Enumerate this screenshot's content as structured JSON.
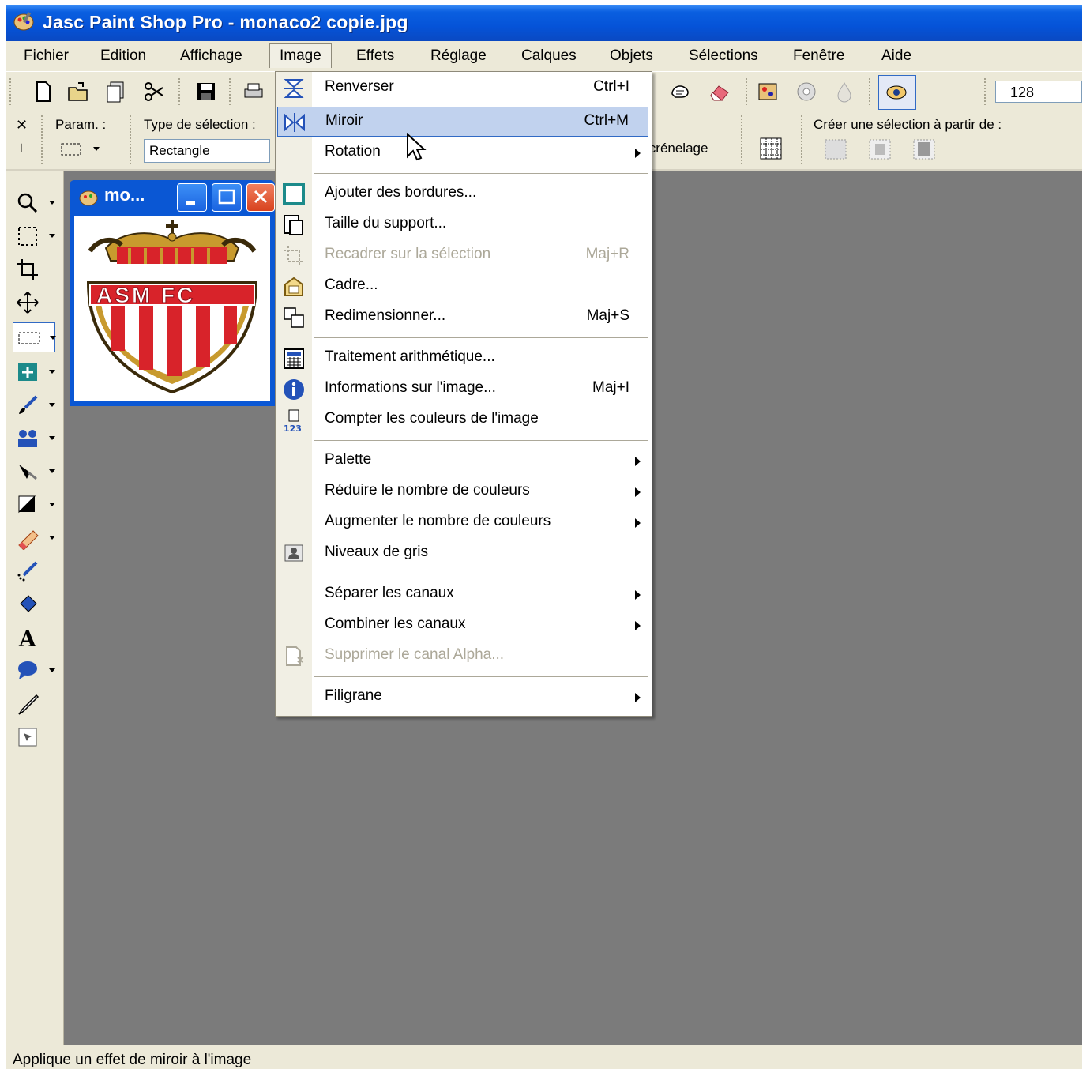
{
  "window": {
    "title": "Jasc Paint Shop Pro - monaco2 copie.jpg"
  },
  "menubar": {
    "items": [
      "Fichier",
      "Edition",
      "Affichage",
      "Image",
      "Effets",
      "Réglage",
      "Calques",
      "Objets",
      "Sélections",
      "Fenêtre",
      "Aide"
    ],
    "active": "Image"
  },
  "toolbar": {
    "size_value": "128"
  },
  "tool_options": {
    "param_label": "Param. :",
    "selection_type_label": "Type de sélection :",
    "selection_type_value": "Rectangle",
    "antialias_partial": "icrénelage",
    "create_selection_label": "Créer une sélection à partir de :"
  },
  "image_window": {
    "title": "mo...",
    "logo_text": "ASM FC"
  },
  "image_menu": {
    "items": [
      {
        "label": "Renverser",
        "shortcut": "Ctrl+I",
        "icon": "flip-icon"
      },
      {
        "label": "Miroir",
        "shortcut": "Ctrl+M",
        "icon": "mirror-icon",
        "highlighted": true
      },
      {
        "label": "Rotation",
        "submenu": true
      },
      {
        "label": "Ajouter des bordures...",
        "icon": "add-borders-icon"
      },
      {
        "label": "Taille du support...",
        "icon": "canvas-size-icon"
      },
      {
        "label": "Recadrer sur la sélection",
        "shortcut": "Maj+R",
        "icon": "crop-selection-icon",
        "disabled": true
      },
      {
        "label": "Cadre...",
        "icon": "frame-icon"
      },
      {
        "label": "Redimensionner...",
        "shortcut": "Maj+S",
        "icon": "resize-icon"
      },
      {
        "label": "Traitement arithmétique...",
        "icon": "calculator-icon"
      },
      {
        "label": "Informations sur l'image...",
        "shortcut": "Maj+I",
        "icon": "info-icon"
      },
      {
        "label": "Compter les couleurs de l'image",
        "icon": "count-colors-icon"
      },
      {
        "label": "Palette",
        "submenu": true
      },
      {
        "label": "Réduire le nombre de couleurs",
        "submenu": true
      },
      {
        "label": "Augmenter le nombre de couleurs",
        "submenu": true
      },
      {
        "label": "Niveaux de gris",
        "icon": "grayscale-icon"
      },
      {
        "label": "Séparer les canaux",
        "submenu": true
      },
      {
        "label": "Combiner les canaux",
        "submenu": true
      },
      {
        "label": "Supprimer le canal Alpha...",
        "icon": "delete-alpha-icon",
        "disabled": true
      },
      {
        "label": "Filigrane",
        "submenu": true
      }
    ]
  },
  "statusbar": {
    "text": "Applique un effet de miroir à l'image"
  },
  "colors": {
    "titlebar": "#0553d8",
    "menu_highlight": "#c1d2ee",
    "workspace": "#7b7b7b",
    "chrome": "#ece9d8"
  }
}
